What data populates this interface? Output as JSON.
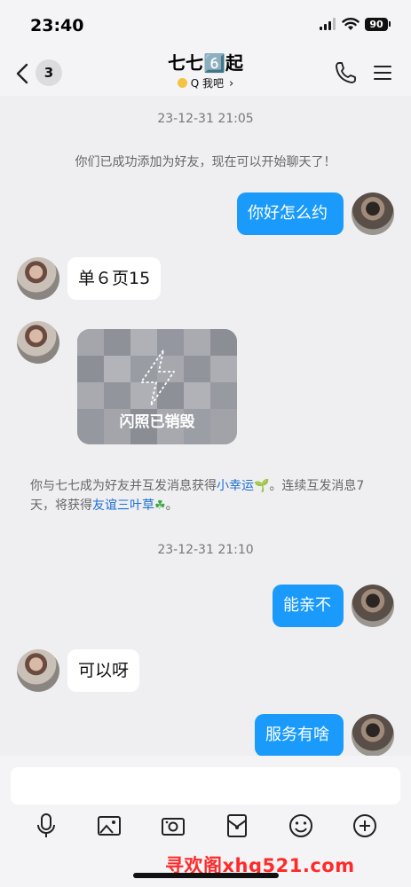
{
  "status": {
    "time": "23:40",
    "battery": "90"
  },
  "nav": {
    "badge": "3",
    "title": "七七6️⃣起",
    "subtitle": "Q 我吧"
  },
  "messages": {
    "ts1": "23-12-31 21:05",
    "sys1": "你们已成功添加为好友，现在可以开始聊天了！",
    "out1": "你好怎么约",
    "in1": "单６页15",
    "flash_label": "闪照已销毁",
    "sys2_a": "你与七七成为好友并互发消息获得",
    "sys2_link1": "小幸运",
    "sys2_b": "。连续互发消息7",
    "sys2_c": "天，将获得",
    "sys2_link2": "友谊三叶草",
    "sys2_d": "。",
    "ts2": "23-12-31 21:10",
    "out2": "能亲不",
    "in2": "可以呀",
    "out3": "服务有啥"
  },
  "toolbar": {
    "icons": [
      "microphone-icon",
      "image-icon",
      "camera-icon",
      "red-packet-icon",
      "emoji-icon",
      "plus-icon"
    ]
  },
  "watermark": "寻欢阁xhg521.com",
  "colors": {
    "accent": "#1a9bfc",
    "link": "#1b6fd6",
    "background": "#efeff1"
  }
}
